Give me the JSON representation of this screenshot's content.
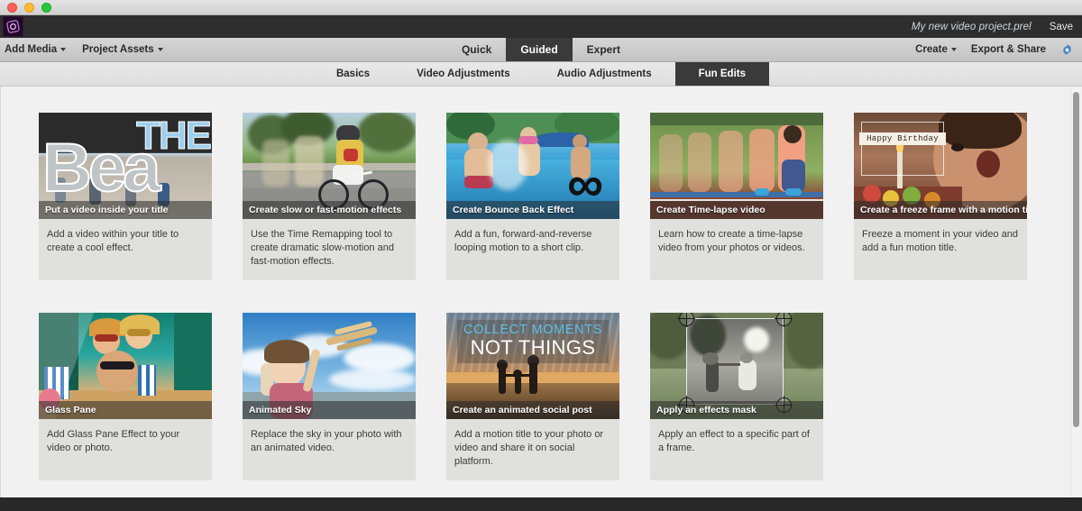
{
  "window": {
    "traffic_lights": [
      "close",
      "minimize",
      "zoom"
    ]
  },
  "app_header": {
    "logo_name": "adobe-premiere-elements-logo",
    "project_name": "My new video project.prel",
    "save_label": "Save"
  },
  "toolbar": {
    "left_items": [
      {
        "label": "Add Media",
        "has_caret": true
      },
      {
        "label": "Project Assets",
        "has_caret": true
      }
    ],
    "mode_tabs": [
      {
        "label": "Quick",
        "active": false
      },
      {
        "label": "Guided",
        "active": true
      },
      {
        "label": "Expert",
        "active": false
      }
    ],
    "right_items": [
      {
        "label": "Create",
        "has_caret": true
      },
      {
        "label": "Export & Share",
        "has_caret": false
      }
    ],
    "settings_icon": "gear-icon"
  },
  "sub_toolbar": {
    "tabs": [
      {
        "label": "Basics",
        "active": false
      },
      {
        "label": "Video Adjustments",
        "active": false
      },
      {
        "label": "Audio Adjustments",
        "active": false
      },
      {
        "label": "Fun Edits",
        "active": true
      }
    ]
  },
  "cards": [
    {
      "caption": "Put a video inside your title",
      "description": "Add a video within your title to create a cool effect.",
      "art": "title-beach",
      "title_line1": "THE",
      "title_line2": "Bea"
    },
    {
      "caption": "Create slow or fast-motion effects",
      "description": "Use the Time Remapping tool to create dramatic slow-motion and fast-motion effects.",
      "art": "bike"
    },
    {
      "caption": "Create Bounce Back Effect",
      "description": "Add a fun, forward-and-reverse looping motion to a short clip.",
      "art": "pool",
      "overlay_glyph": "∞"
    },
    {
      "caption": "Create Time-lapse video",
      "description": "Learn how to create a time-lapse video from your photos or videos.",
      "art": "runner"
    },
    {
      "caption": "Create a freeze frame with a motion title",
      "description": "Freeze a moment in your video and add a fun motion title.",
      "art": "birthday",
      "badge_text": "Happy Birthday"
    },
    {
      "caption": "Glass Pane",
      "description": "Add Glass Pane Effect to your video or photo.",
      "art": "beach-friends"
    },
    {
      "caption": "Animated Sky",
      "description": "Replace the sky in your photo with an animated video.",
      "art": "sky-girl"
    },
    {
      "caption": "Create an animated social post",
      "description": "Add a motion title to your photo or video and share it on social platform.",
      "art": "social-sunset",
      "overlay_line1": "COLLECT MOMENTS",
      "overlay_line2": "NOT THINGS"
    },
    {
      "caption": "Apply an effects mask",
      "description": "Apply an effect to a specific part of a frame.",
      "art": "effects-mask"
    }
  ],
  "scrollbar": {
    "name": "vertical-scrollbar"
  },
  "colors": {
    "accent_dark": "#3a3a3a",
    "app_header_bg": "#2e2e2e",
    "content_bg": "#f1f1f1",
    "card_desc_bg": "#e0e0dd",
    "gear_blue": "#3c82c4"
  }
}
